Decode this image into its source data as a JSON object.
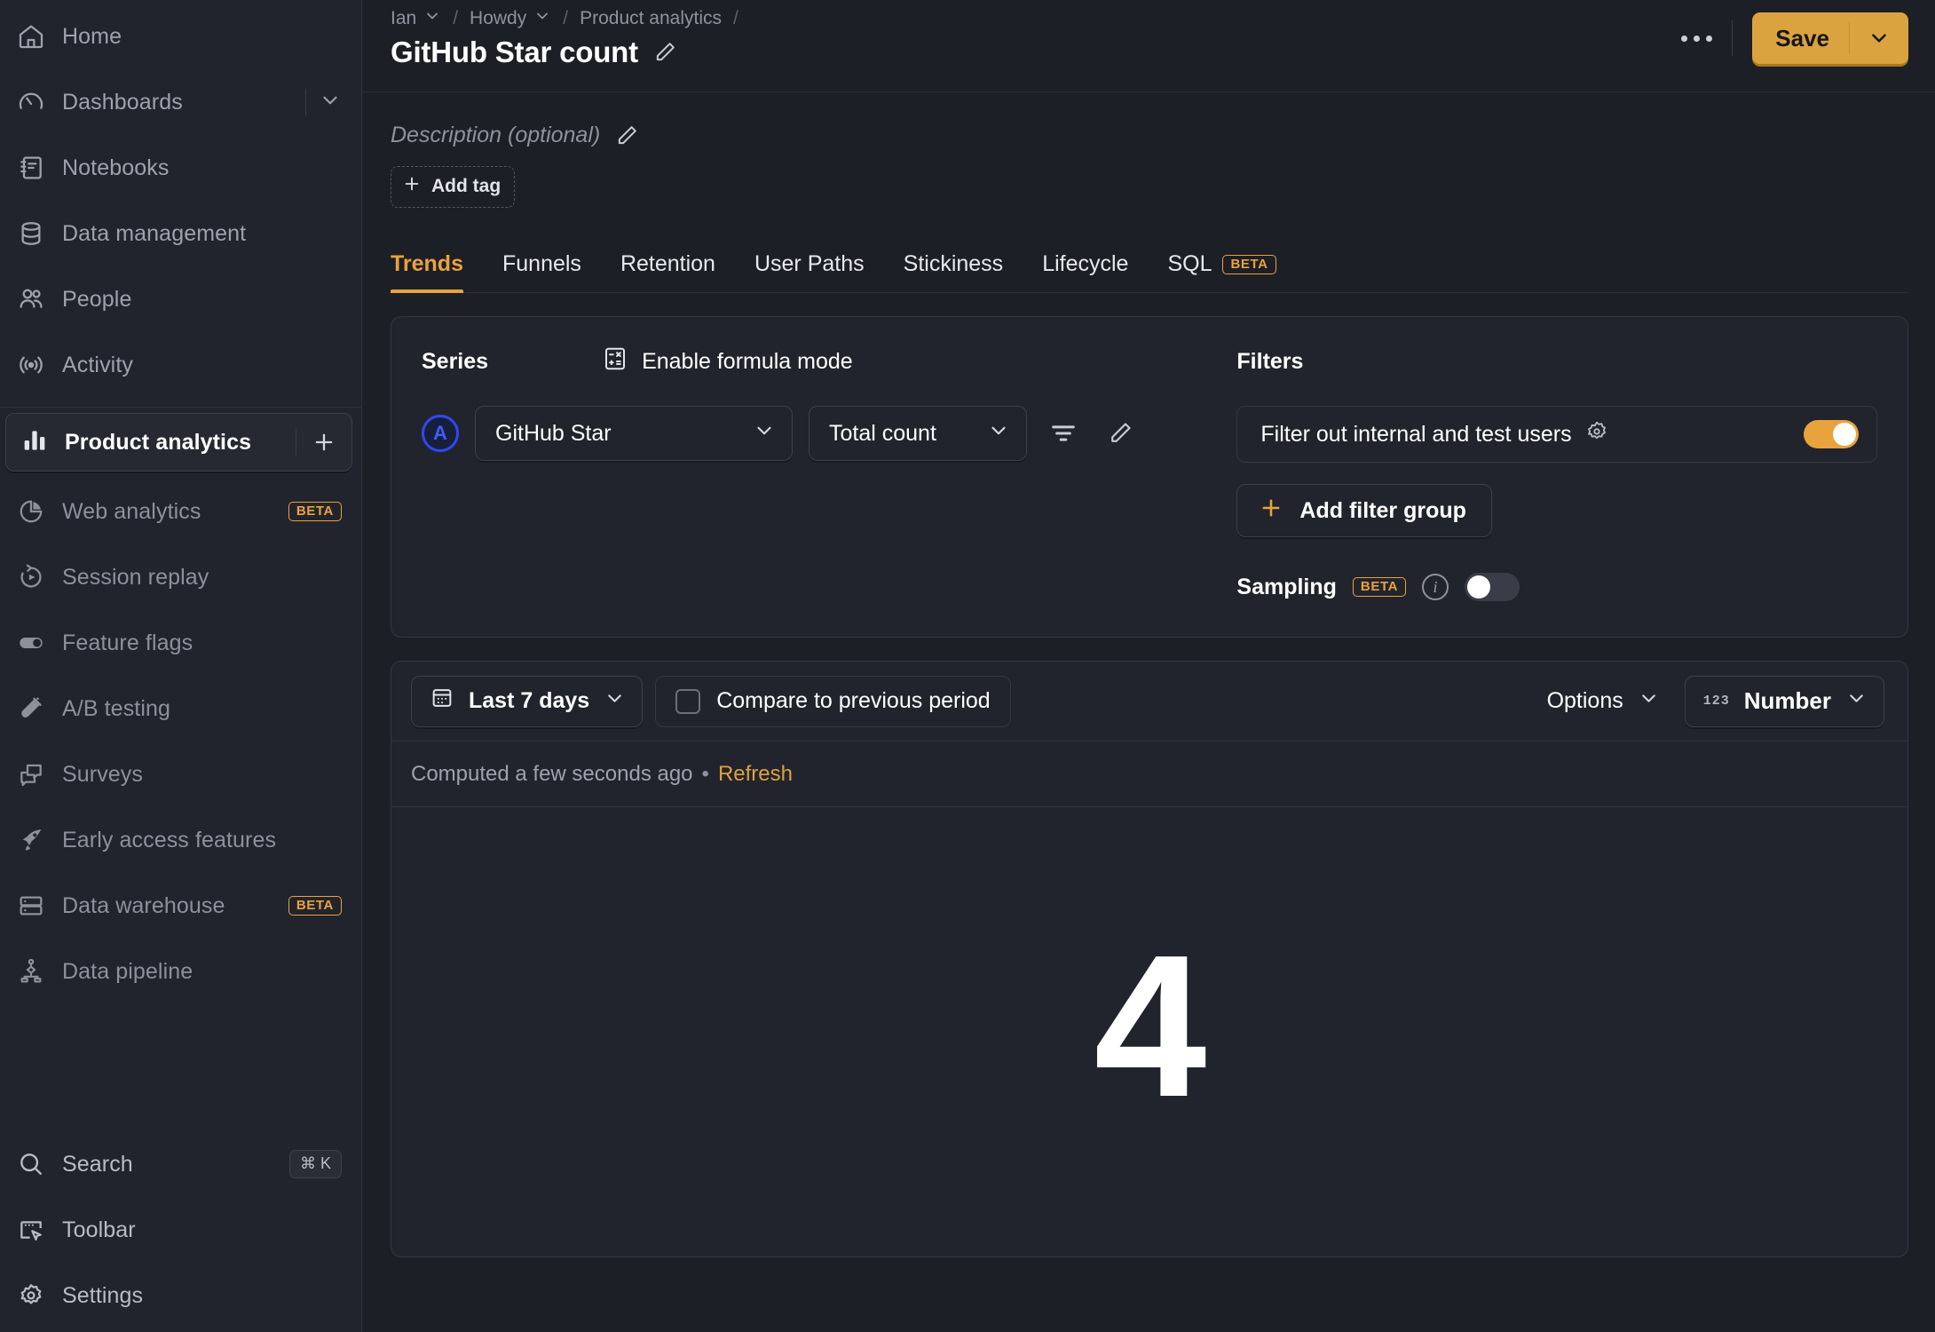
{
  "sidebar": {
    "top_items": [
      {
        "label": "Home",
        "icon": "home-icon"
      },
      {
        "label": "Dashboards",
        "icon": "gauge-icon",
        "has_expand": true
      },
      {
        "label": "Notebooks",
        "icon": "notebook-icon"
      },
      {
        "label": "Data management",
        "icon": "database-icon"
      },
      {
        "label": "People",
        "icon": "people-icon"
      },
      {
        "label": "Activity",
        "icon": "activity-icon"
      }
    ],
    "active_product": {
      "label": "Product analytics",
      "icon": "bar-chart-icon",
      "add_label": "+"
    },
    "product_items": [
      {
        "label": "Web analytics",
        "icon": "pie-chart-icon",
        "badge": "BETA"
      },
      {
        "label": "Session replay",
        "icon": "replay-icon",
        "badge": ""
      },
      {
        "label": "Feature flags",
        "icon": "toggle-icon",
        "badge": ""
      },
      {
        "label": "A/B testing",
        "icon": "flask-icon",
        "badge": ""
      },
      {
        "label": "Surveys",
        "icon": "survey-icon",
        "badge": ""
      },
      {
        "label": "Early access features",
        "icon": "rocket-icon",
        "badge": ""
      },
      {
        "label": "Data warehouse",
        "icon": "warehouse-icon",
        "badge": "BETA"
      },
      {
        "label": "Data pipeline",
        "icon": "pipeline-icon",
        "badge": ""
      }
    ],
    "bottom_items": [
      {
        "label": "Search",
        "icon": "search-icon",
        "kbd": "⌘ K"
      },
      {
        "label": "Toolbar",
        "icon": "toolbar-icon",
        "kbd": ""
      },
      {
        "label": "Settings",
        "icon": "gear-icon",
        "kbd": ""
      }
    ]
  },
  "topbar": {
    "breadcrumbs": [
      {
        "label": "Ian",
        "has_chevron": true
      },
      {
        "label": "Howdy",
        "has_chevron": true
      },
      {
        "label": "Product analytics",
        "has_chevron": false
      }
    ],
    "separator": "/",
    "title": "GitHub Star count",
    "edit_icon": "pencil-icon",
    "more_icon": "ellipsis-icon",
    "save_label": "Save"
  },
  "meta": {
    "description_placeholder": "Description (optional)",
    "description_edit_icon": "pencil-icon",
    "add_tag_label": "Add tag"
  },
  "tabs": [
    {
      "label": "Trends",
      "active": true,
      "badge": ""
    },
    {
      "label": "Funnels",
      "active": false,
      "badge": ""
    },
    {
      "label": "Retention",
      "active": false,
      "badge": ""
    },
    {
      "label": "User Paths",
      "active": false,
      "badge": ""
    },
    {
      "label": "Stickiness",
      "active": false,
      "badge": ""
    },
    {
      "label": "Lifecycle",
      "active": false,
      "badge": ""
    },
    {
      "label": "SQL",
      "active": false,
      "badge": "BETA"
    }
  ],
  "query": {
    "series_title": "Series",
    "formula_label": "Enable formula mode",
    "formula_icon": "calculator-icon",
    "series": [
      {
        "letter": "A",
        "event": "GitHub Star",
        "math": "Total count",
        "filter_icon": "filter-icon",
        "edit_icon": "pencil-icon"
      }
    ],
    "filters_title": "Filters",
    "internal_filter_label": "Filter out internal and test users",
    "internal_filter_gear_icon": "gear-icon",
    "internal_filter_on": true,
    "add_filter_group_label": "Add filter group",
    "sampling_label": "Sampling",
    "sampling_badge": "BETA",
    "sampling_info_icon": "info-icon",
    "sampling_on": false
  },
  "results": {
    "date_range": "Last 7 days",
    "calendar_icon": "calendar-icon",
    "compare_label": "Compare to previous period",
    "compare_checked": false,
    "options_label": "Options",
    "chart_type_label": "Number",
    "chart_type_icon": "number-123-icon",
    "computed_text": "Computed a few seconds ago",
    "computed_separator": "•",
    "refresh_label": "Refresh",
    "big_value": "4"
  },
  "colors": {
    "accent": "#e8a33d",
    "save_bg": "#dba33f",
    "series_a": "#2f49f0",
    "app_bg": "#1d1f27",
    "sidebar_bg": "#22242d",
    "card_bg": "#22242d",
    "border": "#343843",
    "text": "#e8e9ed",
    "muted_text": "#9ea2ad"
  }
}
